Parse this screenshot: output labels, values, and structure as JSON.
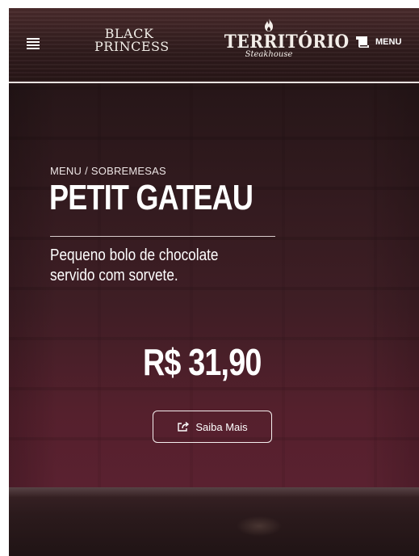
{
  "header": {
    "brand_left_line1": "BLACK",
    "brand_left_line2": "PRINCESS",
    "brand_main": "TERRITÓRIO",
    "brand_main_sub": "Steakhouse",
    "menu_label": "MENU"
  },
  "breadcrumb": {
    "root": "MENU",
    "separator": "/",
    "current": "SOBREMESAS"
  },
  "product": {
    "title": "PETIT GATEAU",
    "description": "Pequeno bolo de chocolate servido com sorvete.",
    "price": "R$ 31,90",
    "cta_label": "Saiba Mais"
  },
  "icons": {
    "hamburger": "hamburger-menu-icon",
    "menu": "scroll-menu-icon",
    "share": "share-icon",
    "flame": "flame-icon"
  },
  "colors": {
    "accent_wine": "#55202d",
    "header_bg": "#2f1b1c",
    "text": "#ffffff"
  }
}
